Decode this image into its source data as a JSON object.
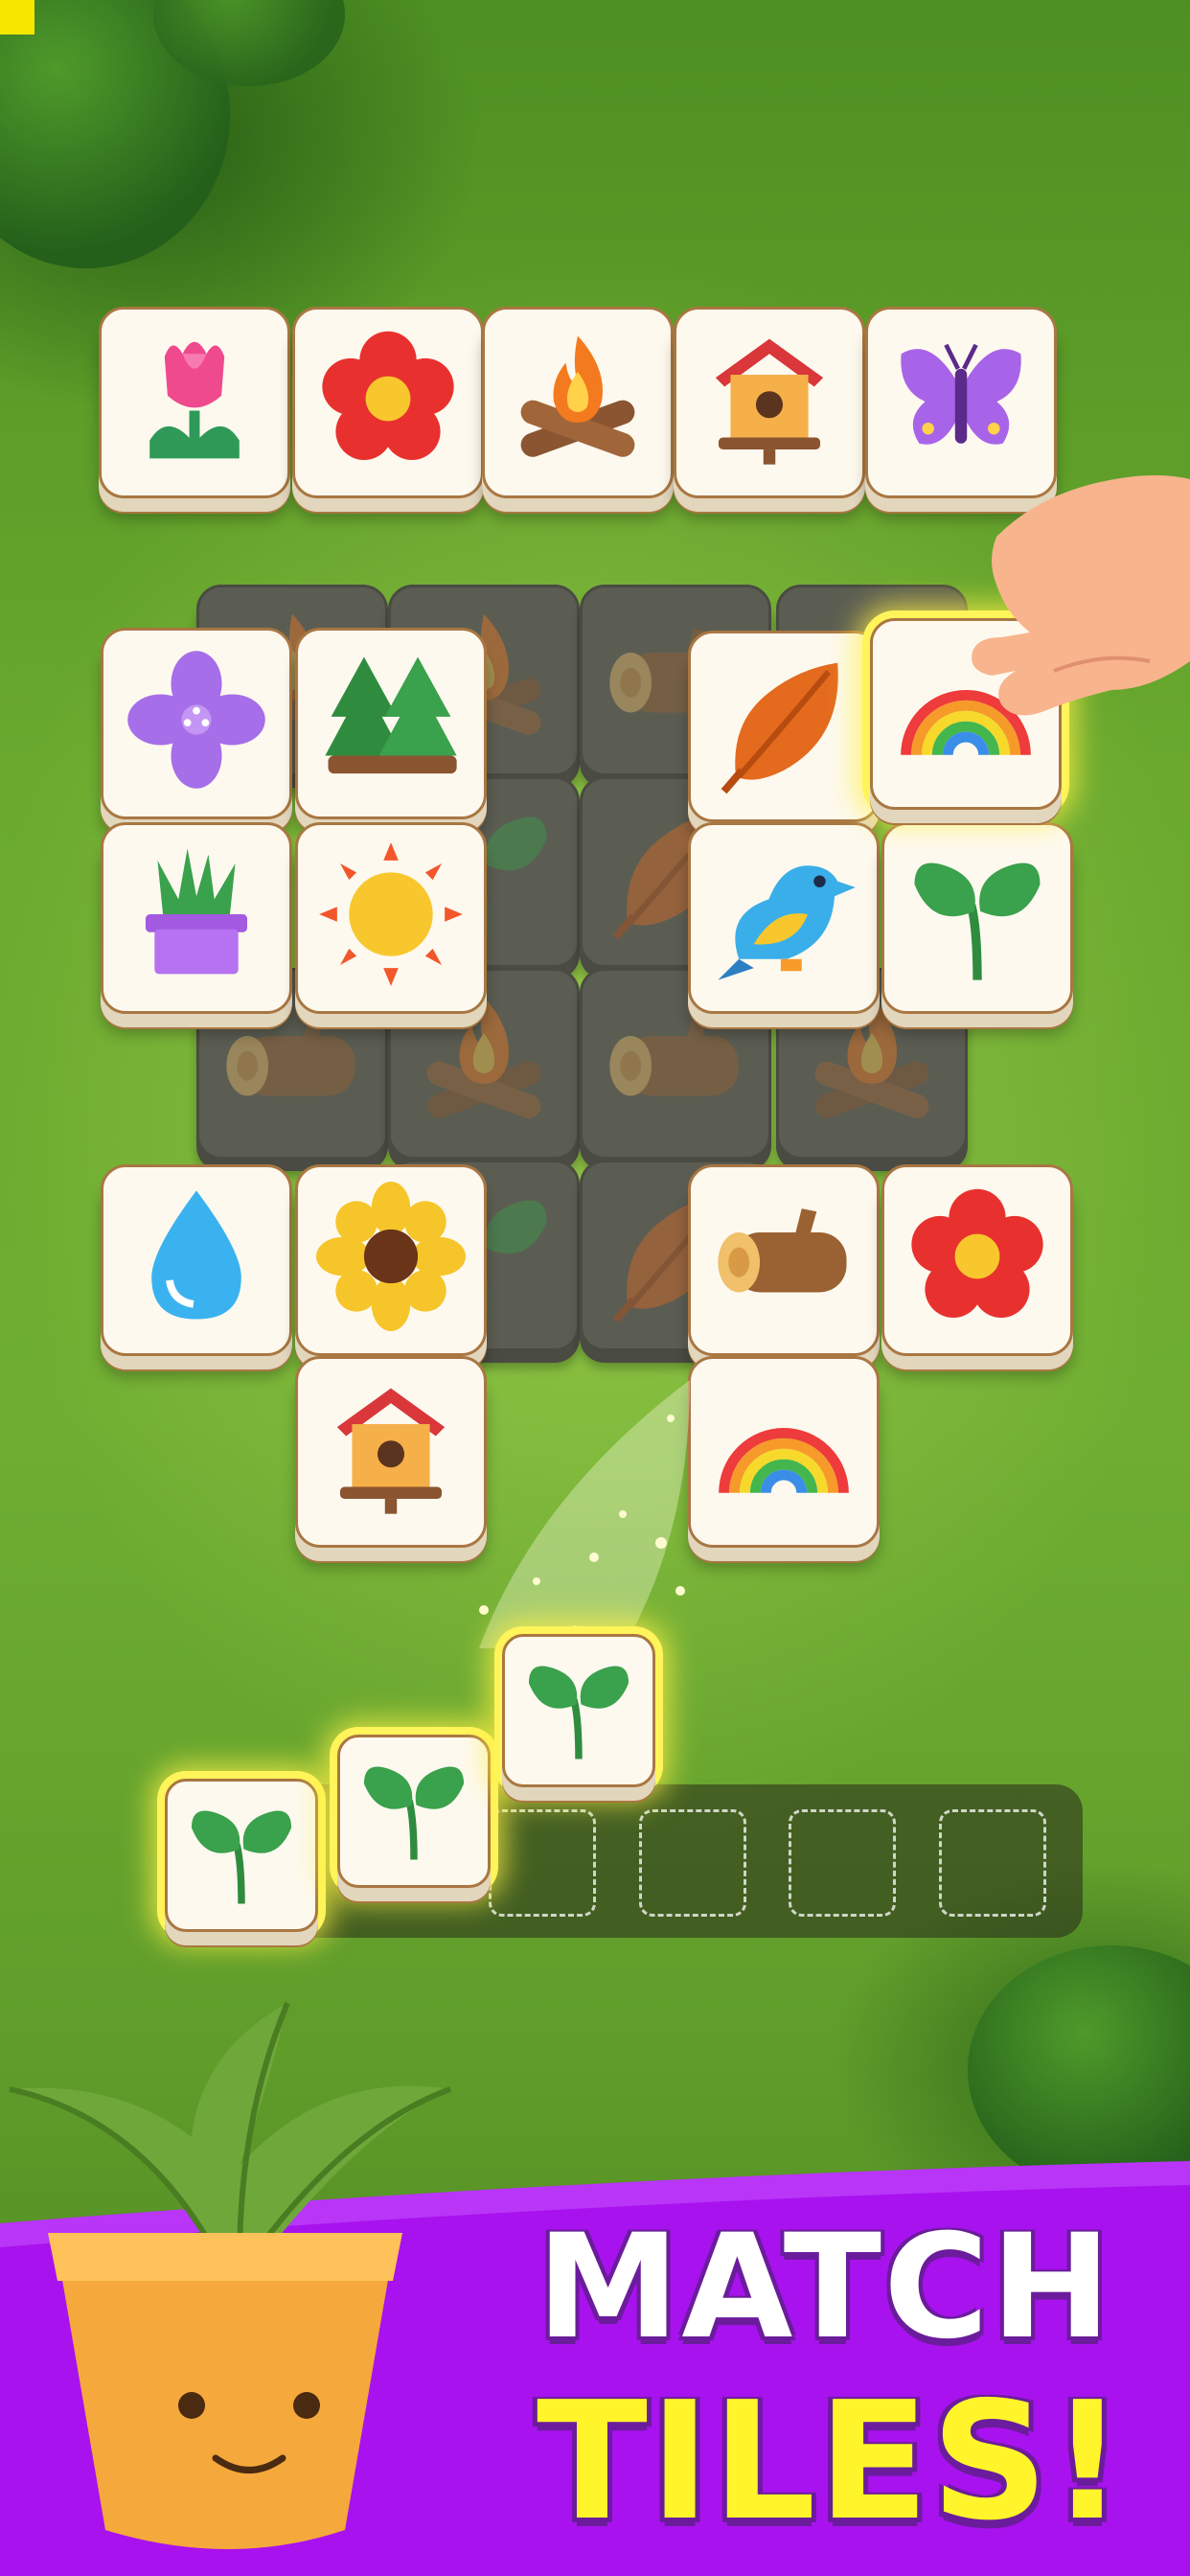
{
  "banner": {
    "line1": "MATCH",
    "line2": "TILES!",
    "bg_color": "#a812ee",
    "line1_color": "#ffffff",
    "line2_color": "#fff52a"
  },
  "board": {
    "top_row": [
      "tulip-icon",
      "red-flower-icon",
      "campfire-icon",
      "birdhouse-icon",
      "butterfly-icon"
    ],
    "left_block": [
      "lilac-flower-icon",
      "pine-trees-icon",
      "potted-grass-icon",
      "sun-icon"
    ],
    "right_block": [
      "leaf-icon",
      "rainbow-icon",
      "bird-icon",
      "sprout-icon"
    ],
    "lower_left": [
      "water-drop-icon",
      "sunflower-icon",
      "birdhouse-icon"
    ],
    "lower_right": [
      "log-icon",
      "red-flower-icon",
      "rainbow-icon"
    ],
    "covered_tiles": [
      "campfire-icon",
      "log-icon",
      "sprout-icon",
      "leaf-icon",
      "log-icon",
      "campfire-icon",
      "log-icon",
      "campfire-icon",
      "sprout-icon",
      "leaf-icon"
    ],
    "highlighted_tile": "rainbow-icon"
  },
  "tray": {
    "capacity": 7,
    "filled": [
      "sprout-icon",
      "sprout-icon"
    ],
    "incoming": "sprout-icon"
  },
  "colors": {
    "grass": "#6aa92e",
    "tile_face": "#fdf9ef",
    "tile_border": "#a97742",
    "highlight": "#fff45a"
  }
}
